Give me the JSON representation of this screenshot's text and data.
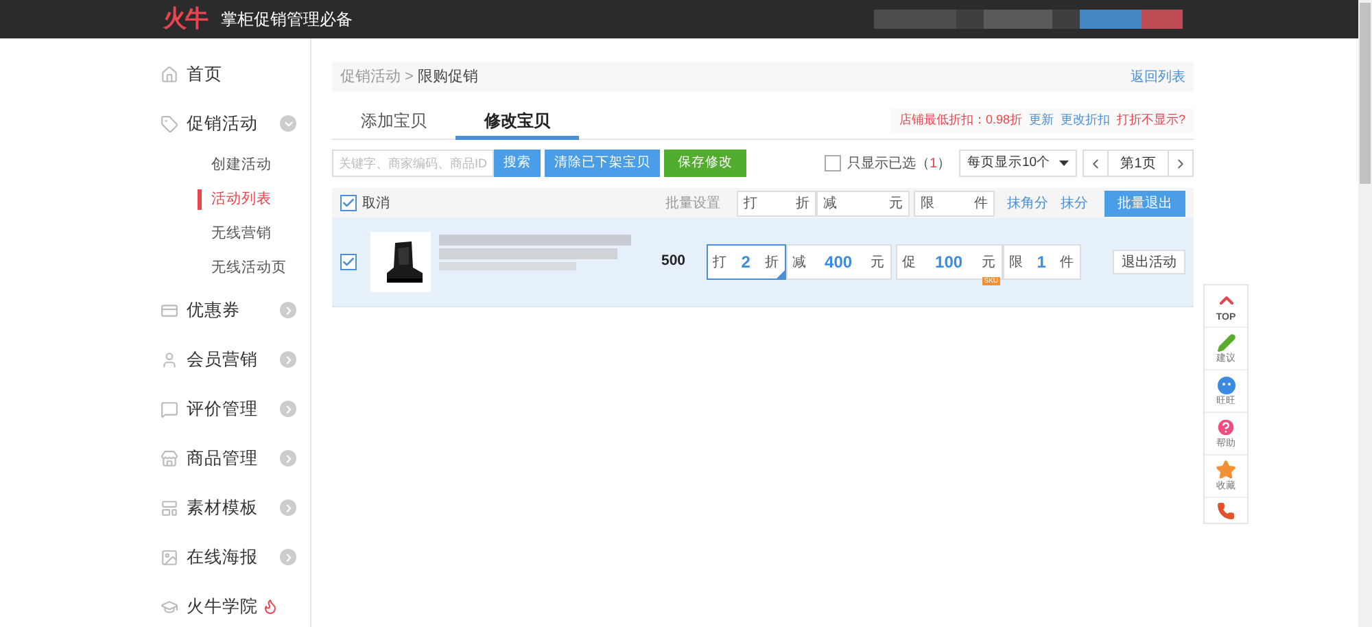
{
  "header": {
    "logo": "火牛",
    "slogan": "掌柜促销管理必备"
  },
  "sidebar": {
    "items": [
      {
        "kind": "home",
        "label": "首页"
      },
      {
        "kind": "promo",
        "label": "促销活动",
        "expanded": true,
        "children": [
          {
            "label": "创建活动",
            "selected": false
          },
          {
            "label": "活动列表",
            "selected": true
          },
          {
            "label": "无线营销",
            "selected": false
          },
          {
            "label": "无线活动页",
            "selected": false
          }
        ]
      },
      {
        "kind": "coupon",
        "label": "优惠券",
        "expanded": false
      },
      {
        "kind": "member",
        "label": "会员营销",
        "expanded": false
      },
      {
        "kind": "review",
        "label": "评价管理",
        "expanded": false
      },
      {
        "kind": "goods",
        "label": "商品管理",
        "expanded": false
      },
      {
        "kind": "template",
        "label": "素材模板",
        "expanded": false
      },
      {
        "kind": "poster",
        "label": "在线海报",
        "expanded": false
      },
      {
        "kind": "school",
        "label": "火牛学院",
        "hot": true
      }
    ]
  },
  "breadcrumb": {
    "parent": "促销活动",
    "separator": ">",
    "current": "限购促销",
    "back_link": "返回列表"
  },
  "tabs": [
    {
      "label": "添加宝贝",
      "selected": false
    },
    {
      "label": "修改宝贝",
      "selected": true
    }
  ],
  "notice": {
    "text": "店铺最低折扣：0.98折",
    "links": [
      "更新",
      "更改折扣"
    ],
    "warning": "打折不显示?"
  },
  "toolbar": {
    "search": {
      "placeholder": "关键字、商家编码、商品ID"
    },
    "buttons": [
      {
        "kind": "primary",
        "label": "搜索"
      },
      {
        "kind": "primary",
        "label": "清除已下架宝贝"
      },
      {
        "kind": "success",
        "label": "保存修改"
      }
    ],
    "show_selected": {
      "label": "只显示已选（",
      "count": "1",
      "close": "）",
      "checked": false
    },
    "page_size": "每页显示10个",
    "page": "第1页"
  },
  "batch": {
    "select_all": {
      "label": "取消",
      "checked": true
    },
    "label": "批量设置",
    "fields": [
      {
        "prefix": "打",
        "suffix": "折"
      },
      {
        "prefix": "减",
        "suffix": "元"
      },
      {
        "prefix": "限",
        "suffix": "件"
      }
    ],
    "links": [
      "抹角分",
      "抹分"
    ],
    "button": "批量退出"
  },
  "rows": [
    {
      "checked": true,
      "stock": "500",
      "fields": [
        {
          "prefix": "打",
          "value": "2",
          "suffix": "折",
          "focused": true
        },
        {
          "prefix": "减",
          "value": "400",
          "suffix": "元",
          "focused": false
        },
        {
          "prefix": "促",
          "value": "100",
          "suffix": "元",
          "focused": false,
          "badge": "SKU"
        },
        {
          "prefix": "限",
          "value": "1",
          "suffix": "件",
          "focused": false
        }
      ],
      "action": "退出活动"
    }
  ],
  "float_toolbar": [
    {
      "kind": "top",
      "label": "TOP"
    },
    {
      "kind": "suggest",
      "label": "建议"
    },
    {
      "kind": "chat",
      "label": "旺旺"
    },
    {
      "kind": "help",
      "label": "帮助"
    },
    {
      "kind": "favorite",
      "label": "收藏"
    },
    {
      "kind": "phone"
    }
  ]
}
